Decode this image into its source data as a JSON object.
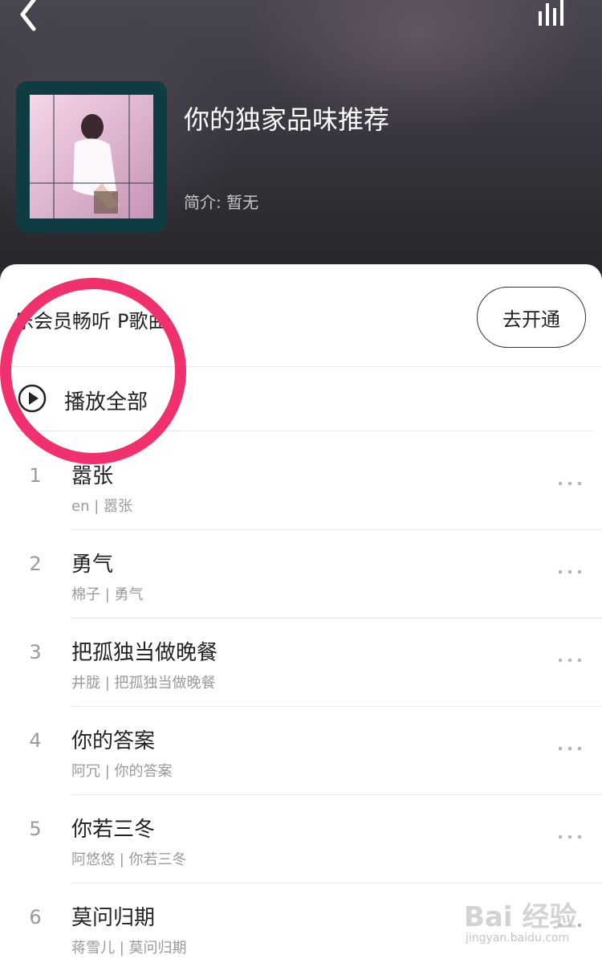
{
  "header": {
    "title": "你的独家品味推荐",
    "intro": "简介: 暂无",
    "back_icon": "chevron-left-icon",
    "equalizer_icon": "equalizer-icon"
  },
  "vip_banner": {
    "text": "乐会员畅听",
    "text_tail": "P歌曲",
    "button_label": "去开通"
  },
  "play_all": {
    "label": "播放全部",
    "icon": "play-circle-icon"
  },
  "tracks": [
    {
      "number": "1",
      "title": "嚣张",
      "subtitle": "en | 嚣张"
    },
    {
      "number": "2",
      "title": "勇气",
      "subtitle": "棉子 | 勇气"
    },
    {
      "number": "3",
      "title": "把孤独当做晚餐",
      "subtitle": "井胧 | 把孤独当做晚餐"
    },
    {
      "number": "4",
      "title": "你的答案",
      "subtitle": "阿冗 | 你的答案"
    },
    {
      "number": "5",
      "title": "你若三冬",
      "subtitle": "阿悠悠 | 你若三冬"
    },
    {
      "number": "6",
      "title": "莫问归期",
      "subtitle": "蒋雪儿 | 莫问归期"
    }
  ],
  "colors": {
    "annotation": "#f0316d",
    "cover_frame": "#0f3c41"
  },
  "watermark": {
    "main": "Bai 经验",
    "sub": "jingyan.baidu.com"
  }
}
